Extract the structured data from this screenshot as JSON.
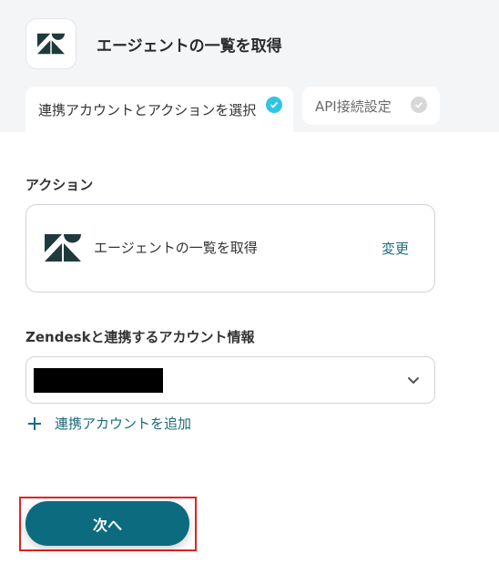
{
  "header": {
    "app_icon": "zendesk-logo",
    "title": "エージェントの一覧を取得"
  },
  "tabs": [
    {
      "label": "連携アカウントとアクションを選択",
      "status": "complete"
    },
    {
      "label": "API接続設定",
      "status": "incomplete"
    }
  ],
  "action_section": {
    "label": "アクション",
    "action_name": "エージェントの一覧を取得",
    "change_label": "変更"
  },
  "account_section": {
    "label": "Zendeskと連携するアカウント情報",
    "selected_value": "",
    "add_account_label": "連携アカウントを追加"
  },
  "footer": {
    "next_label": "次へ"
  },
  "colors": {
    "accent": "#0d6b80",
    "link": "#1b6b7c",
    "check_active": "#2ec6e6",
    "check_inactive": "#d8d8d8",
    "highlight": "#e02424"
  }
}
